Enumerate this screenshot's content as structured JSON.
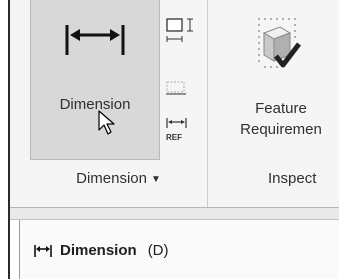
{
  "ribbon": {
    "dimension_button": {
      "label": "Dimension",
      "icon": "horizontal-dimension-icon"
    },
    "small_buttons": [
      {
        "icon": "ordinate-dimension-icon"
      },
      {
        "icon": "baseline-dimension-icon"
      },
      {
        "icon": "reference-dimension-icon"
      }
    ],
    "feature_button": {
      "line1": "Feature",
      "line2": "Requiremen",
      "icon": "feature-requirement-icon"
    },
    "groups": {
      "dimension": "Dimension",
      "dimension_caret": "▼",
      "inspect": "Inspect"
    }
  },
  "tooltip": {
    "title": "Dimension",
    "shortcut": "(D)",
    "icon": "horizontal-dimension-icon"
  },
  "colors": {
    "accent_check": "#222222",
    "cube": "#d9d9d9",
    "button_pressed": "#d8d8d8"
  }
}
